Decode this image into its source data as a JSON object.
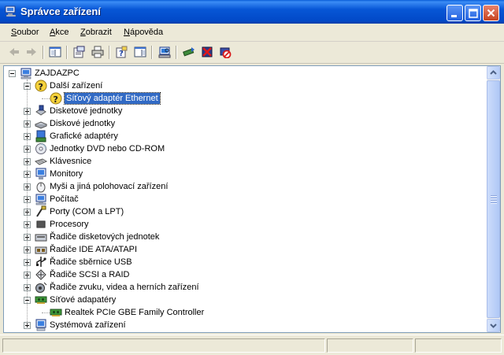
{
  "window": {
    "title": "Správce zařízení",
    "colors": {
      "titlebar": "#0249C7",
      "selection": "#316AC5",
      "window_bg": "#ECE9D8"
    }
  },
  "title_buttons": [
    {
      "name": "minimize-button",
      "icon": "minimize-icon"
    },
    {
      "name": "maximize-button",
      "icon": "maximize-icon"
    },
    {
      "name": "close-button",
      "icon": "close-icon"
    }
  ],
  "menu": {
    "items": [
      {
        "label": "Soubor",
        "accel": "S"
      },
      {
        "label": "Akce",
        "accel": "A"
      },
      {
        "label": "Zobrazit",
        "accel": "Z"
      },
      {
        "label": "Nápověda",
        "accel": "N"
      }
    ]
  },
  "toolbar": {
    "buttons": [
      {
        "name": "back-button",
        "icon": "back-arrow-icon"
      },
      {
        "name": "forward-button",
        "icon": "forward-arrow-icon"
      },
      {
        "name": "show-hide-tree-button",
        "icon": "console-tree-icon"
      },
      {
        "name": "properties-button",
        "icon": "properties-icon"
      },
      {
        "name": "print-button",
        "icon": "printer-icon"
      },
      {
        "name": "help-button",
        "icon": "help-icon"
      },
      {
        "name": "show-hide-action-pane-button",
        "icon": "action-pane-icon"
      },
      {
        "name": "scan-hardware-button",
        "icon": "scan-hardware-icon"
      },
      {
        "name": "update-driver-button",
        "icon": "update-driver-icon"
      },
      {
        "name": "uninstall-button",
        "icon": "uninstall-icon"
      },
      {
        "name": "disable-button",
        "icon": "disable-device-icon"
      }
    ]
  },
  "tree": {
    "root": {
      "label": "ZAJDAZPC",
      "icon": "computer-icon",
      "expanded": true
    },
    "nodes": [
      {
        "label": "Další zařízení",
        "icon": "unknown-device-icon",
        "expanded": true,
        "children": [
          {
            "label": "Síťový adaptér Ethernet",
            "icon": "unknown-device-icon",
            "selected": true
          }
        ]
      },
      {
        "label": "Disketové jednotky",
        "icon": "floppy-drive-icon",
        "expanded": false
      },
      {
        "label": "Diskové jednotky",
        "icon": "disk-drive-icon",
        "expanded": false
      },
      {
        "label": "Grafické adaptéry",
        "icon": "display-adapter-icon",
        "expanded": false
      },
      {
        "label": "Jednotky DVD nebo CD-ROM",
        "icon": "cdrom-icon",
        "expanded": false
      },
      {
        "label": "Klávesnice",
        "icon": "keyboard-icon",
        "expanded": false
      },
      {
        "label": "Monitory",
        "icon": "monitor-icon",
        "expanded": false
      },
      {
        "label": "Myši a jiná polohovací zařízení",
        "icon": "mouse-icon",
        "expanded": false
      },
      {
        "label": "Počítač",
        "icon": "computer-icon",
        "expanded": false
      },
      {
        "label": "Porty (COM a LPT)",
        "icon": "port-icon",
        "expanded": false
      },
      {
        "label": "Procesory",
        "icon": "processor-icon",
        "expanded": false
      },
      {
        "label": "Řadiče disketových jednotek",
        "icon": "floppy-controller-icon",
        "expanded": false
      },
      {
        "label": "Řadiče IDE ATA/ATAPI",
        "icon": "ide-controller-icon",
        "expanded": false
      },
      {
        "label": "Řadiče sběrnice USB",
        "icon": "usb-icon",
        "expanded": false
      },
      {
        "label": "Řadiče SCSI a RAID",
        "icon": "scsi-icon",
        "expanded": false
      },
      {
        "label": "Řadiče zvuku, videa a herních zařízení",
        "icon": "sound-icon",
        "expanded": false
      },
      {
        "label": "Síťové adapatéry",
        "icon": "network-adapter-icon",
        "expanded": true,
        "children": [
          {
            "label": "Realtek PCIe GBE Family Controller",
            "icon": "network-adapter-icon"
          }
        ]
      },
      {
        "label": "Systémová zařízení",
        "icon": "system-device-icon",
        "expanded": false
      }
    ]
  },
  "statusbar": {
    "panes": [
      "",
      "",
      ""
    ]
  }
}
